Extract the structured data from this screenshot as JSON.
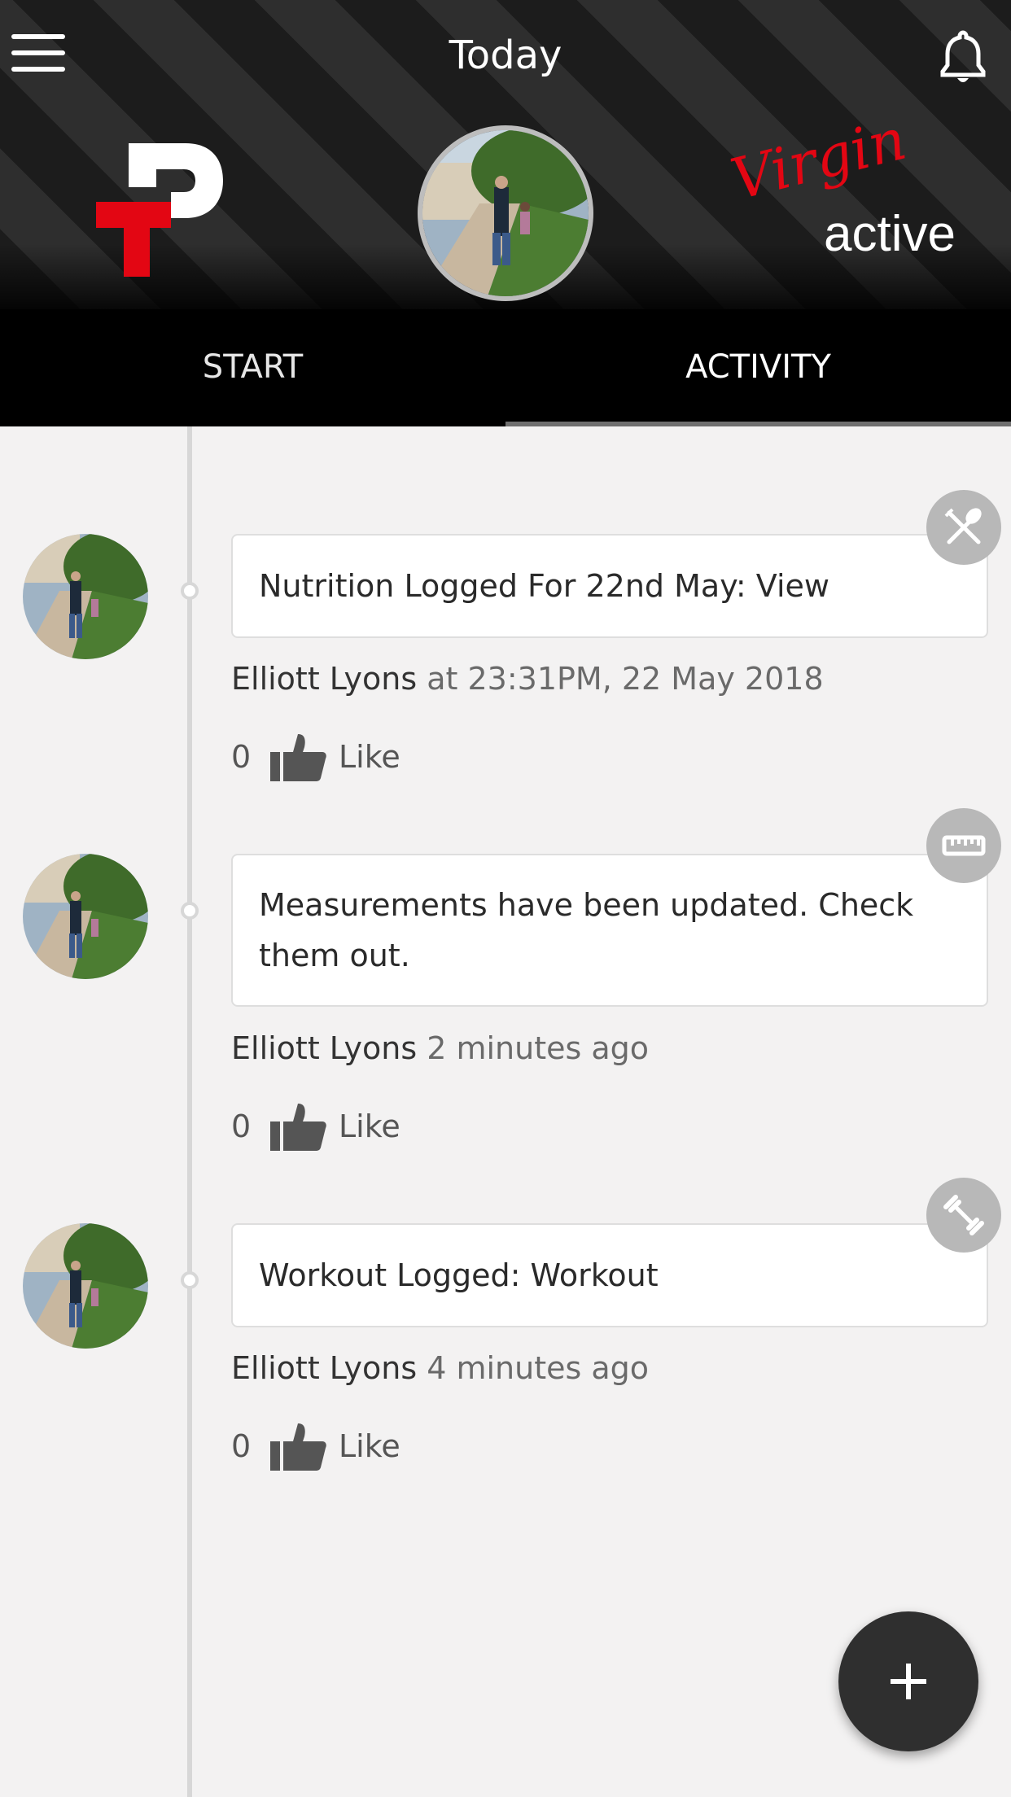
{
  "header": {
    "title": "Today",
    "logo_left": "PT logo",
    "brand": {
      "script": "Virgin",
      "word": "active",
      "brand_red": "#e30613"
    },
    "menu_icon": "hamburger-menu-icon",
    "notification_icon": "bell-icon"
  },
  "tabs": [
    {
      "label": "START",
      "selected": false
    },
    {
      "label": "ACTIVITY",
      "selected": true
    }
  ],
  "feed": [
    {
      "type_icon": "fork-knife-icon",
      "text": "Nutrition Logged For 22nd May: View",
      "user": "Elliott Lyons",
      "when": "at 23:31PM, 22 May 2018",
      "likes": "0",
      "like_label": "Like"
    },
    {
      "type_icon": "ruler-icon",
      "text": "Measurements have been updated. Check them out.",
      "user": "Elliott Lyons",
      "when": "2 minutes ago",
      "likes": "0",
      "like_label": "Like"
    },
    {
      "type_icon": "dumbbell-icon",
      "text": "Workout Logged: Workout",
      "user": "Elliott Lyons",
      "when": "4 minutes ago",
      "likes": "0",
      "like_label": "Like"
    }
  ],
  "fab": {
    "icon": "plus-icon"
  },
  "colors": {
    "header_bg": "#000000",
    "feed_bg": "#f3f2f2",
    "icon_badge": "#b8b8b8",
    "fab_bg": "#2f2f2f"
  }
}
